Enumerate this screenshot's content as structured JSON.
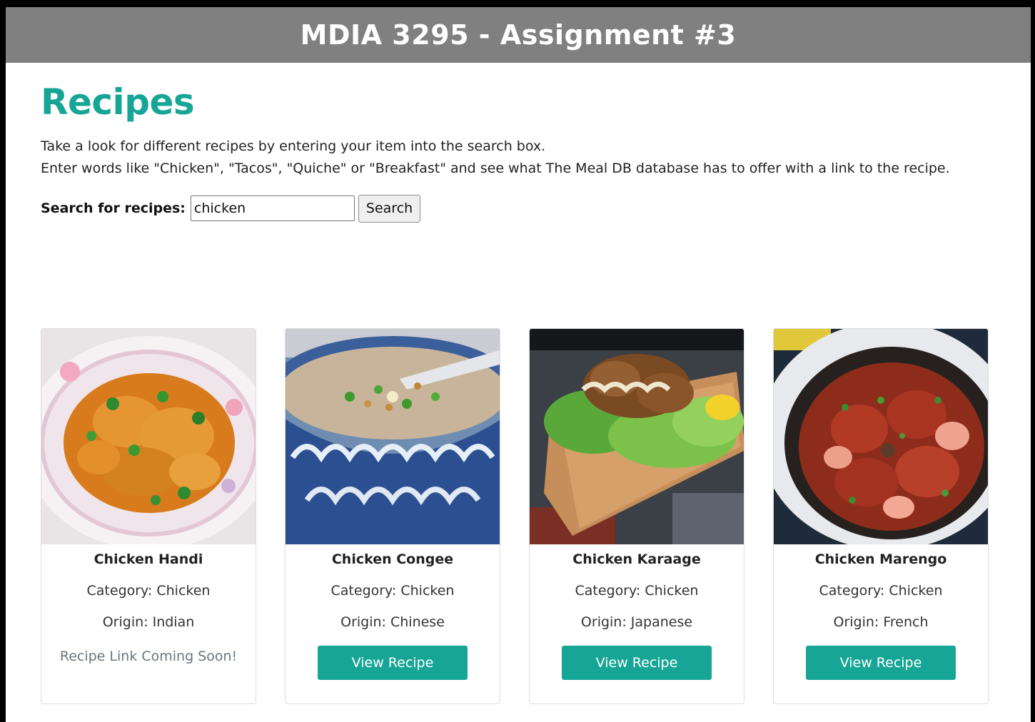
{
  "header": {
    "title": "MDIA 3295 - Assignment #3"
  },
  "page": {
    "title": "Recipes",
    "description_line1": "Take a look for different recipes by entering your item into the search box.",
    "description_line2": "Enter words like \"Chicken\", \"Tacos\", \"Quiche\" or \"Breakfast\" and see what The Meal DB database has to offer with a link to the recipe."
  },
  "search": {
    "label": "Search for recipes:",
    "value": "chicken",
    "button_label": "Search"
  },
  "colors": {
    "accent": "#17a596",
    "header_bg": "#808080"
  },
  "cards": [
    {
      "title": "Chicken Handi",
      "category": "Category: Chicken",
      "origin": "Origin: Indian",
      "link_text": "Recipe Link Coming Soon!",
      "button_label": ""
    },
    {
      "title": "Chicken Congee",
      "category": "Category: Chicken",
      "origin": "Origin: Chinese",
      "link_text": "",
      "button_label": "View Recipe"
    },
    {
      "title": "Chicken Karaage",
      "category": "Category: Chicken",
      "origin": "Origin: Japanese",
      "link_text": "",
      "button_label": "View Recipe"
    },
    {
      "title": "Chicken Marengo",
      "category": "Category: Chicken",
      "origin": "Origin: French",
      "link_text": "",
      "button_label": "View Recipe"
    }
  ]
}
